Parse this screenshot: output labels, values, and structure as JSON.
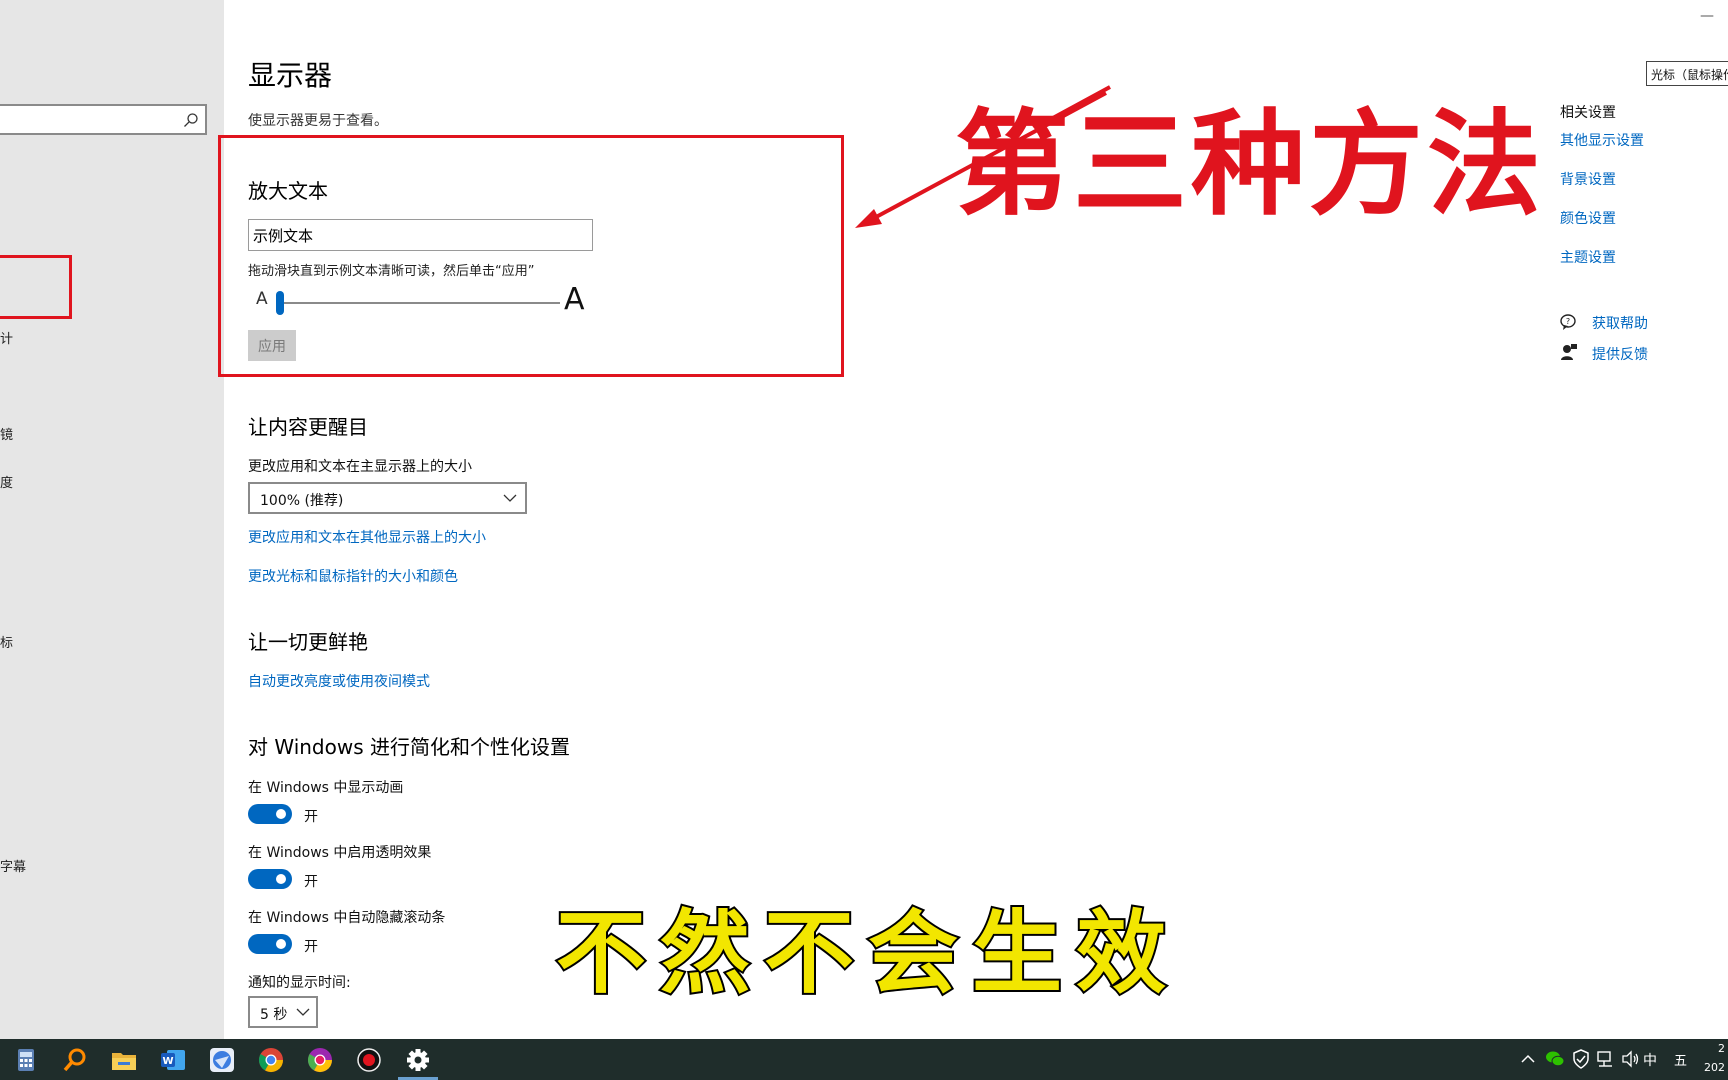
{
  "sidebar": {
    "search_placeholder": "",
    "fragments": [
      "计",
      "镜",
      "度",
      "标",
      "字幕"
    ]
  },
  "main": {
    "title": "显示器",
    "subtitle": "使显示器更易于查看。",
    "enlarge_text": {
      "title": "放大文本",
      "sample_text": "示例文本",
      "hint": "拖动滑块直到示例文本清晰可读，然后单击“应用”",
      "small_a": "A",
      "big_a": "A",
      "slider_value": 0,
      "apply_label": "应用"
    },
    "make_content_bigger": {
      "title": "让内容更醒目",
      "size_label": "更改应用和文本在主显示器上的大小",
      "size_value": "100% (推荐)",
      "link_other_display": "更改应用和文本在其他显示器上的大小",
      "link_cursor": "更改光标和鼠标指针的大小和颜色"
    },
    "make_brighter": {
      "title": "让一切更鲜艳",
      "link_night": "自动更改亮度或使用夜间模式"
    },
    "simplify": {
      "title": "对 Windows 进行简化和个性化设置",
      "toggles": [
        {
          "label": "在 Windows 中显示动画",
          "state": "开",
          "on": true
        },
        {
          "label": "在 Windows 中启用透明效果",
          "state": "开",
          "on": true
        },
        {
          "label": "在 Windows 中自动隐藏滚动条",
          "state": "开",
          "on": true
        }
      ],
      "notify_label": "通知的显示时间:",
      "notify_value": "5 秒"
    }
  },
  "annotations": {
    "headline": "第三种方法",
    "caption": "不然不会生效",
    "headline_color": "#e0141e",
    "caption_color": "#f2e600"
  },
  "right_pane": {
    "related_title": "相关设置",
    "links": [
      "其他显示设置",
      "背景设置",
      "颜色设置",
      "主题设置"
    ],
    "help": "获取帮助",
    "feedback": "提供反馈",
    "tooltip": "光标（鼠标操作",
    "minimize": "—"
  },
  "taskbar": {
    "apps": [
      "calculator-icon",
      "search-icon",
      "file-explorer-icon",
      "word-icon",
      "browser-icon",
      "chrome-icon",
      "chrome-canary-icon",
      "record-icon",
      "settings-icon"
    ],
    "ime": "中",
    "ime_mode": "五",
    "clock_line1": "2",
    "clock_line2": "202"
  },
  "colors": {
    "accent": "#0067c0",
    "annotation_red": "#e0141e",
    "taskbar": "#1f2d2b"
  }
}
